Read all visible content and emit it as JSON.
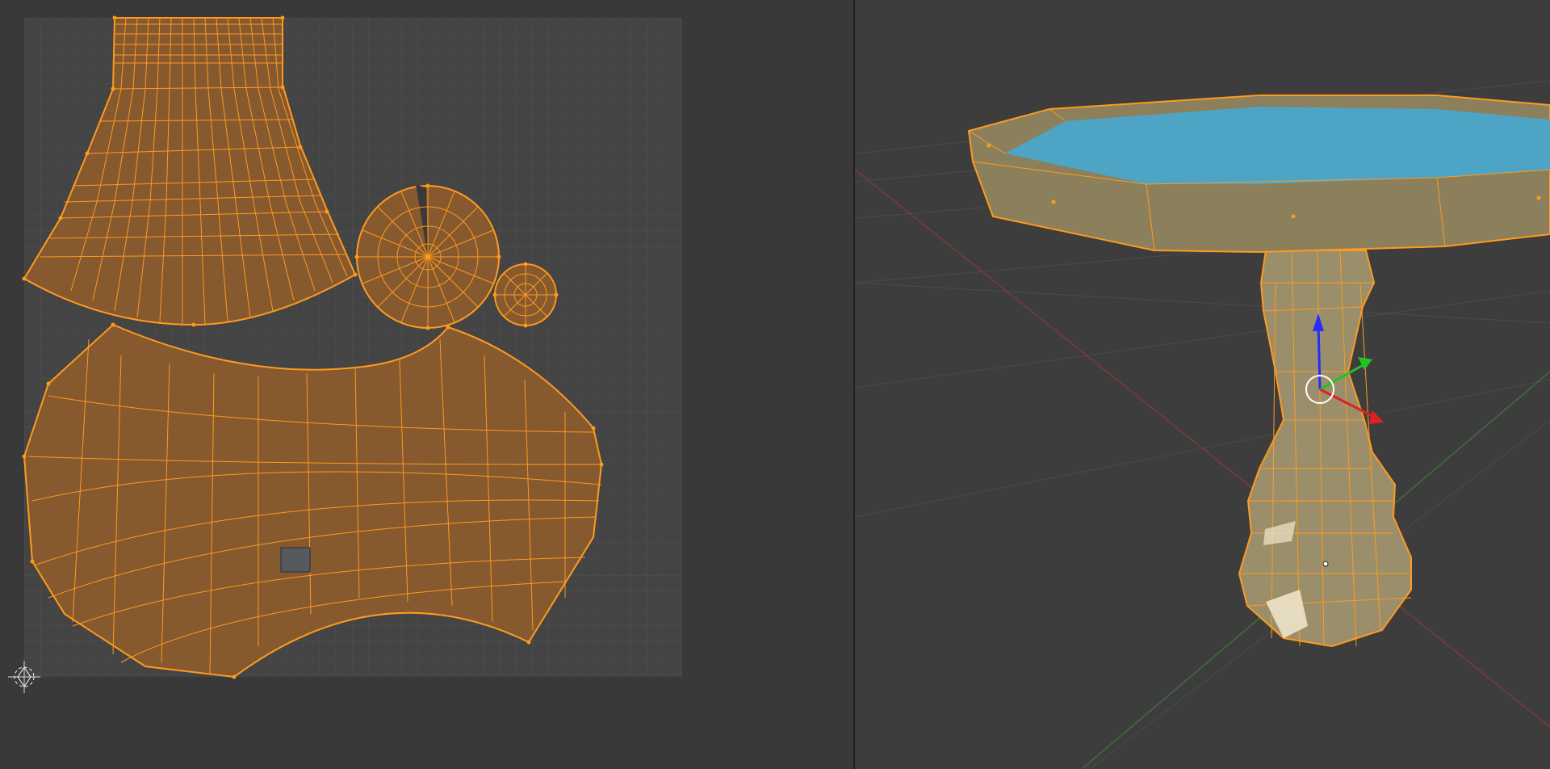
{
  "editors": {
    "uv_editor": {
      "kind": "UV Editor"
    },
    "viewport": {
      "kind": "3D Viewport"
    }
  },
  "icons": {
    "cursor": "2d-cursor-icon",
    "gizmo": "transform-gizmo-icon"
  },
  "colors": {
    "background": "#393939",
    "uv_grid": "#4a4a4a",
    "uv_face": "#86592e",
    "selection": "#ff9a1f",
    "water": "#4ea4c4",
    "stone": "#8c7f5c",
    "axis_x": "#e02020",
    "axis_y": "#22c422",
    "axis_z": "#2a2aff"
  }
}
